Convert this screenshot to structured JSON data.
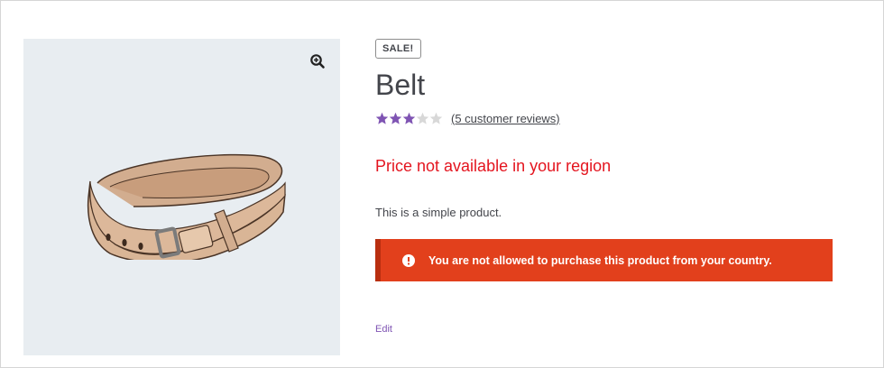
{
  "product": {
    "sale_badge": "SALE!",
    "title": "Belt",
    "rating": 3,
    "rating_max": 5,
    "reviews_link": "(5 customer reviews)",
    "price_text": "Price not available in your region",
    "short_description": "This is a simple product.",
    "notice_text": "You are not allowed to purchase this product from your country.",
    "edit_link": "Edit"
  },
  "gallery": {
    "image_subject": "belt",
    "zoom_icon": "zoom-in-icon"
  },
  "colors": {
    "star_filled": "#7f54b3",
    "star_empty": "#d8d8d8",
    "price_red": "#e4151f",
    "notice_bg": "#e2401c",
    "link_purple": "#7f54b3"
  }
}
